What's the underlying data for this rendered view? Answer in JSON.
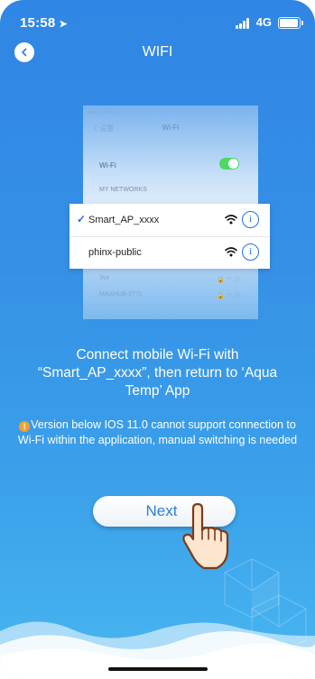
{
  "status_bar": {
    "time": "15:58",
    "network": "4G"
  },
  "nav": {
    "title": "WIFI"
  },
  "illustration": {
    "screenshot_back": "设置",
    "screenshot_title": "Wi-Fi",
    "wifi_label": "Wi-Fi",
    "my_networks": "MY NETWORKS",
    "networks": [
      {
        "name": "Smart_AP_xxxx",
        "connected": true
      },
      {
        "name": "phinx-public",
        "connected": false
      }
    ],
    "faded_networks": [
      "3ve",
      "MAXHUB-277c"
    ]
  },
  "instruction": "Connect mobile Wi-Fi with “Smart_AP_xxxx”, then return to ‘Aqua Temp’ App",
  "warning": "Version below IOS 11.0 cannot support connection to Wi-Fi within the application, manual switching is needed",
  "next_button": {
    "label": "Next"
  },
  "colors": {
    "background_top": "#2f86e4",
    "background_bottom": "#48b6f0",
    "accent": "#1a73e8",
    "warning": "#f4a12a"
  }
}
